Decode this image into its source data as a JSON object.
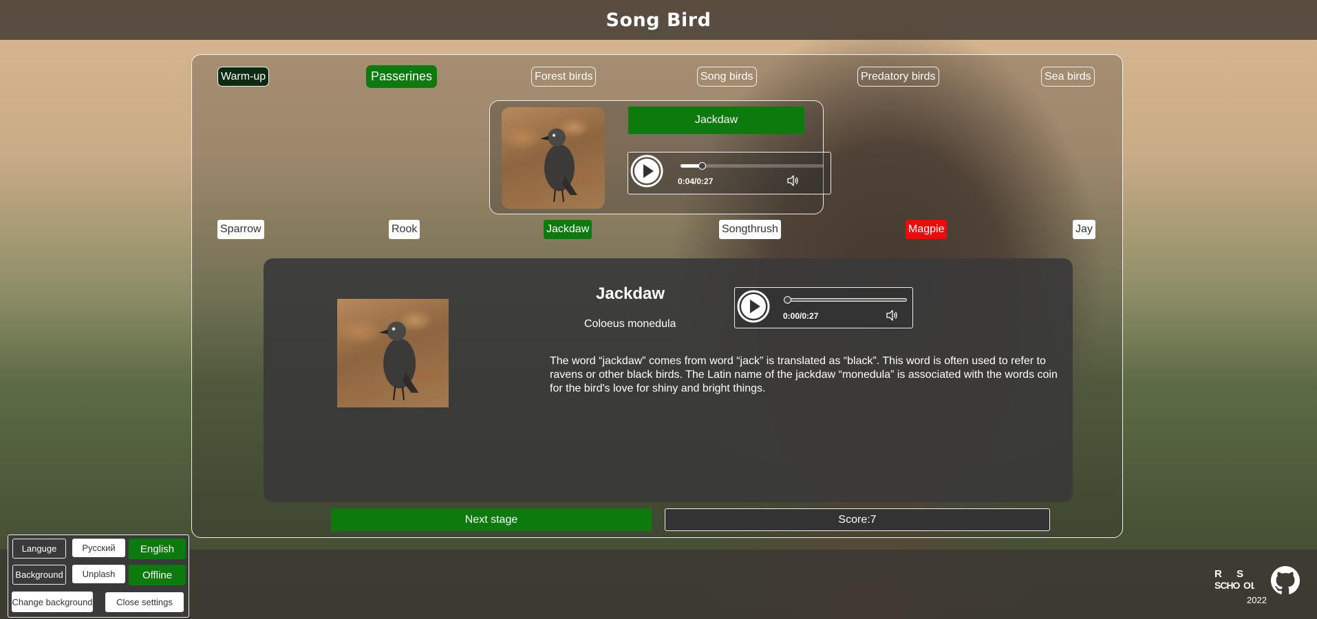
{
  "app": {
    "title": "Song Bird"
  },
  "categories": [
    {
      "label": "Warm-up",
      "state": "done"
    },
    {
      "label": "Passerines",
      "state": "active"
    },
    {
      "label": "Forest birds",
      "state": "normal"
    },
    {
      "label": "Song birds",
      "state": "normal"
    },
    {
      "label": "Predatory birds",
      "state": "normal"
    },
    {
      "label": "Sea birds",
      "state": "normal"
    }
  ],
  "question": {
    "answer": "Jackdaw",
    "player": {
      "time": "0:04/0:27",
      "progress": 0.15
    }
  },
  "options": [
    {
      "label": "Sparrow",
      "state": "normal"
    },
    {
      "label": "Rook",
      "state": "normal"
    },
    {
      "label": "Jackdaw",
      "state": "correct"
    },
    {
      "label": "Songthrush",
      "state": "normal"
    },
    {
      "label": "Magpie",
      "state": "wrong"
    },
    {
      "label": "Jay",
      "state": "normal"
    }
  ],
  "details": {
    "name": "Jackdaw",
    "latin": "Coloeus monedula",
    "description": "The word “jackdaw” comes from word “jack” is translated as “black”. This word is often used to refer to ravens or other black birds. The Latin name of the jackdaw “monedula” is associated with the words coin for the bird's love for shiny and bright things.",
    "player": {
      "time": "0:00/0:27",
      "progress": 0.0
    }
  },
  "actions": {
    "next": "Next stage",
    "score": "Score:7"
  },
  "settings": {
    "language_label": "Languge",
    "russian": "Русский",
    "english": "English",
    "background_label": "Background",
    "unsplash": "Unplash",
    "offline": "Offline",
    "change_background": "Change background",
    "close": "Close settings"
  },
  "footer": {
    "logo": "RS SCHOOL",
    "year": "2022"
  },
  "colors": {
    "accent": "#0c7a0c",
    "wrong": "#ee0a0a"
  },
  "icons": [
    "play-icon",
    "volume-icon",
    "github-icon",
    "rs-school-logo"
  ]
}
